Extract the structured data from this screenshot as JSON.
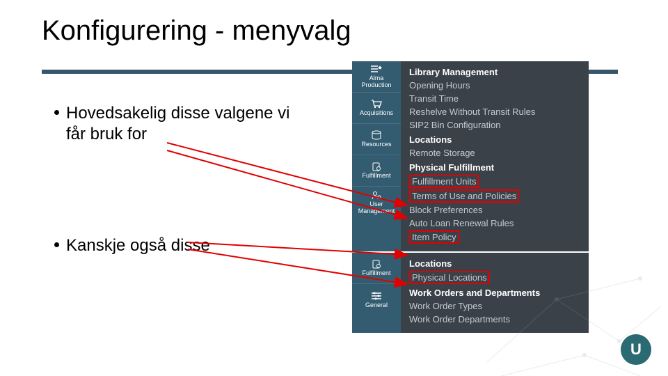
{
  "title": "Konfigurering - menyvalg",
  "bullets": {
    "b1_line1": "Hovedsakelig disse valgene vi",
    "b1_line2": "får bruk for",
    "b2": "Kanskje også disse"
  },
  "icons": {
    "alma": "Alma",
    "alma2": "Production",
    "acq": "Acquisitions",
    "res": "Resources",
    "ful": "Fulfillment",
    "usr": "User",
    "usr2": "Management",
    "ful2": "Fulfillment",
    "gen": "General"
  },
  "menu": {
    "s1_h1": "Library Management",
    "s1_i1": "Opening Hours",
    "s1_i2": "Transit Time",
    "s1_i3": "Reshelve Without Transit Rules",
    "s1_i4": "SIP2 Bin Configuration",
    "s1_h2": "Locations",
    "s1_i5": "Remote Storage",
    "s1_h3": "Physical Fulfillment",
    "s1_i6": "Fulfillment Units",
    "s1_i7": "Terms of Use and Policies",
    "s1_i8": "Block Preferences",
    "s1_i9": "Auto Loan Renewal Rules",
    "s1_i10": "Item Policy",
    "s2_h1": "Locations",
    "s2_i1": "Physical Locations",
    "s2_h2": "Work Orders and Departments",
    "s2_i2": "Work Order Types",
    "s2_i3": "Work Order Departments"
  },
  "logo": "U"
}
